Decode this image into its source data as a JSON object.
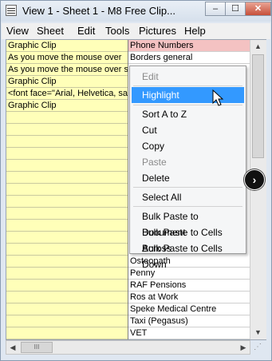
{
  "window": {
    "title": "View 1  -  Sheet 1  -  M8 Free Clip...",
    "min": "–",
    "max": "☐",
    "close": "✕"
  },
  "menubar": [
    "View",
    "Sheet",
    "Edit",
    "Tools",
    "Pictures",
    "Help"
  ],
  "column_a": [
    "Graphic Clip",
    "As you move the mouse over",
    "As you move the mouse over s",
    "Graphic Clip",
    "<font face=\"Arial, Helvetica, sa",
    "Graphic Clip",
    "",
    "",
    "",
    "",
    "",
    "",
    "",
    "",
    "",
    "",
    "",
    "",
    "",
    "",
    "",
    "",
    "",
    "",
    ""
  ],
  "column_b_top": [
    "Phone Numbers",
    "Borders general"
  ],
  "column_b_bottom": [
    "Osteopath",
    "Penny",
    "RAF Pensions",
    "Ros at Work",
    "Speke Medical Centre",
    "Taxi (Pegasus)",
    "VET"
  ],
  "context_menu": [
    {
      "label": "Edit",
      "state": "disabled"
    },
    {
      "label": "Highlight",
      "state": "selected"
    },
    {
      "label": "Sort A to Z",
      "state": "normal"
    },
    {
      "label": "Cut",
      "state": "normal"
    },
    {
      "label": "Copy",
      "state": "normal"
    },
    {
      "label": "Paste",
      "state": "disabled"
    },
    {
      "label": "Delete",
      "state": "normal"
    },
    {
      "label": "Select All",
      "state": "normal"
    },
    {
      "label": "Bulk Paste to Document",
      "state": "normal"
    },
    {
      "label": "Bulk Paste to Cells Across",
      "state": "normal"
    },
    {
      "label": "Bulk Paste to Cells Down",
      "state": "normal"
    }
  ],
  "scroll": {
    "up": "▲",
    "down": "▼",
    "left": "◀",
    "right": "▶",
    "thumb_grip": "III"
  },
  "circle_button": "›",
  "colors": {
    "column_a": "#ffffb9",
    "highlight_row": "#f4c2c2",
    "menu_selected": "#3399ff"
  }
}
